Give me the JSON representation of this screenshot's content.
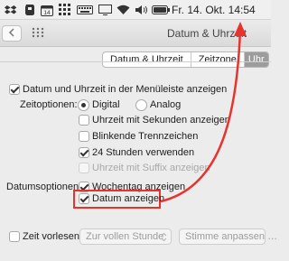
{
  "menubar": {
    "clock": "Fr. 14. Okt.  14:54",
    "icons": [
      "dropbox-icon",
      "evernote-icon",
      "calendar-icon",
      "grid-icon",
      "keyboard-icon",
      "screen-icon",
      "wifi-icon",
      "volume-icon",
      "battery-icon"
    ]
  },
  "window": {
    "title": "Datum & Uhrzeit",
    "back_icon": "chevron-left-icon",
    "grid_icon": "grid-icon"
  },
  "tabs": [
    {
      "label": "Datum & Uhrzeit",
      "selected": false
    },
    {
      "label": "Zeitzone",
      "selected": false
    },
    {
      "label": "Uhr",
      "selected": true
    }
  ],
  "clock_prefs": {
    "show_in_menubar": {
      "label": "Datum und Uhrzeit in der Menüleiste anzeigen",
      "checked": true
    },
    "time_options_label": "Zeitoptionen:",
    "radio_digital": {
      "label": "Digital",
      "selected": true
    },
    "radio_analog": {
      "label": "Analog",
      "selected": false
    },
    "seconds": {
      "label": "Uhrzeit mit Sekunden anzeigen",
      "checked": false
    },
    "flash_separators": {
      "label": "Blinkende Trennzeichen",
      "checked": false
    },
    "use_24h": {
      "label": "24 Stunden verwenden",
      "checked": true
    },
    "ampm": {
      "label": "Uhrzeit mit Suffix anzeigen",
      "checked": false,
      "disabled": true
    },
    "date_options_label": "Datumsoptionen:",
    "weekday": {
      "label": "Wochentag anzeigen",
      "checked": true
    },
    "show_date": {
      "label": "Datum anzeigen",
      "checked": true
    },
    "announce": {
      "label": "Zeit vorlesen:",
      "checked": false
    },
    "announce_interval": "Zur vollen Stunde",
    "customize_voice": "Stimme anpassen …"
  },
  "annotation": {
    "color": "#e8322b"
  }
}
